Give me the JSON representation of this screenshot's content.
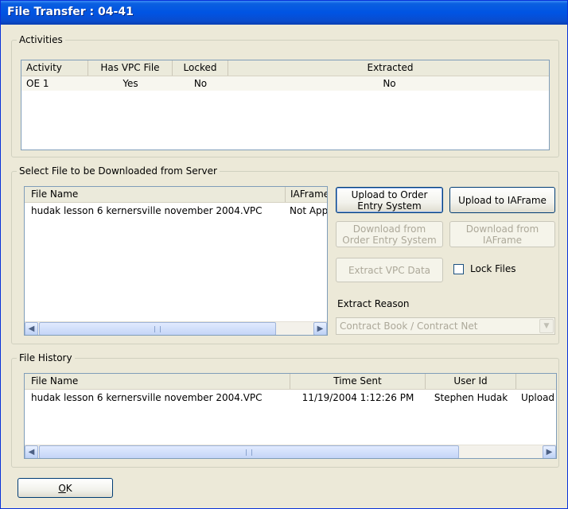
{
  "window": {
    "title": "File Transfer : 04-41"
  },
  "activities": {
    "legend": "Activities",
    "columns": [
      "Activity",
      "Has VPC File",
      "Locked",
      "Extracted"
    ],
    "rows": [
      {
        "activity": "OE 1",
        "has_vpc": "Yes",
        "locked": "No",
        "extracted": "No"
      }
    ]
  },
  "select": {
    "legend": "Select File to be Downloaded from Server",
    "columns": [
      "File Name",
      "IAFrame"
    ],
    "rows": [
      {
        "file_name": "hudak lesson 6 kernersville november 2004.VPC",
        "iaframe": "Not Applicable"
      }
    ],
    "buttons": {
      "upload_oe": "Upload to Order Entry System",
      "upload_ia": "Upload to IAFrame",
      "download_oe": "Download from Order Entry System",
      "download_ia": "Download from IAFrame",
      "extract": "Extract VPC Data"
    },
    "lock_files": "Lock Files",
    "extract_reason_label": "Extract Reason",
    "extract_reason_value": "Contract Book / Contract Net"
  },
  "history": {
    "legend": "File History",
    "columns": [
      "File Name",
      "Time Sent",
      "User Id",
      ""
    ],
    "rows": [
      {
        "file_name": "hudak lesson 6 kernersville november 2004.VPC",
        "time_sent": "11/19/2004 1:12:26 PM",
        "user_id": "Stephen Hudak",
        "action": "Upload"
      }
    ]
  },
  "ok": {
    "underline": "O",
    "rest": "K"
  },
  "colors": {
    "titlebar": "#0054e3",
    "dialog_bg": "#ece9d8",
    "selected_row": "#f7f6ef"
  }
}
